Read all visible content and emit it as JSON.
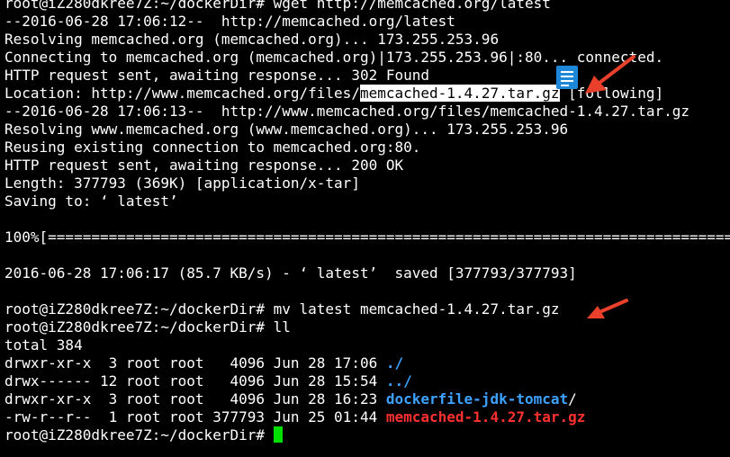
{
  "terminal": {
    "lines": [
      "root@iZ280dkree7Z:~/dockerDir# wget http://memcached.org/latest",
      "--2016-06-28 17:06:12--  http://memcached.org/latest",
      "Resolving memcached.org (memcached.org)... 173.255.253.96",
      "Connecting to memcached.org (memcached.org)|173.255.253.96|:80... connected.",
      "HTTP request sent, awaiting response... 302 Found",
      null,
      "--2016-06-28 17:06:13--  http://www.memcached.org/files/memcached-1.4.27.tar.gz",
      "Resolving www.memcached.org (www.memcached.org)... 173.255.253.96",
      "Reusing existing connection to memcached.org:80.",
      "HTTP request sent, awaiting response... 200 OK",
      "Length: 377793 (369K) [application/x-tar]",
      "Saving to: ‘ latest’",
      "",
      "100%[================================================================================",
      "",
      "2016-06-28 17:06:17 (85.7 KB/s) - ‘ latest’  saved [377793/377793]",
      "",
      "root@iZ280dkree7Z:~/dockerDir# mv latest memcached-1.4.27.tar.gz",
      "root@iZ280dkree7Z:~/dockerDir# ll",
      "total 384"
    ],
    "location_line": {
      "prefix": "Location: http://www.memcached.org/files/",
      "highlight": "memcached-1.4.27.tar.gz",
      "suffix": " [following]"
    },
    "listing": [
      {
        "info": "drwxr-xr-x  3 root root   4096 Jun 28 17:06 ",
        "name": "./",
        "kind": "plain"
      },
      {
        "info": "drwx------ 12 root root   4096 Jun 28 15:54 ",
        "name": "../",
        "kind": "plain"
      },
      {
        "info": "drwxr-xr-x  3 root root   4096 Jun 28 16:23 ",
        "name": "dockerfile-jdk-tomcat",
        "trailing": "/",
        "kind": "dir"
      },
      {
        "info": "-rw-r--r--  1 root root 377793 Jun 25 01:44 ",
        "name": "memcached-1.4.27.tar.gz",
        "kind": "archive"
      }
    ],
    "prompt": "root@iZ280dkree7Z:~/dockerDir# "
  },
  "colors": {
    "background": "#000000",
    "foreground": "#ffffff",
    "directory": "#3da2ff",
    "archive": "#ff3030",
    "cursor": "#00e000",
    "annotation_arrow": "#e8402a",
    "doc_icon": "#1e88d8"
  },
  "icons": {
    "annotation_arrow": "arrow-icon",
    "document": "document-icon"
  }
}
